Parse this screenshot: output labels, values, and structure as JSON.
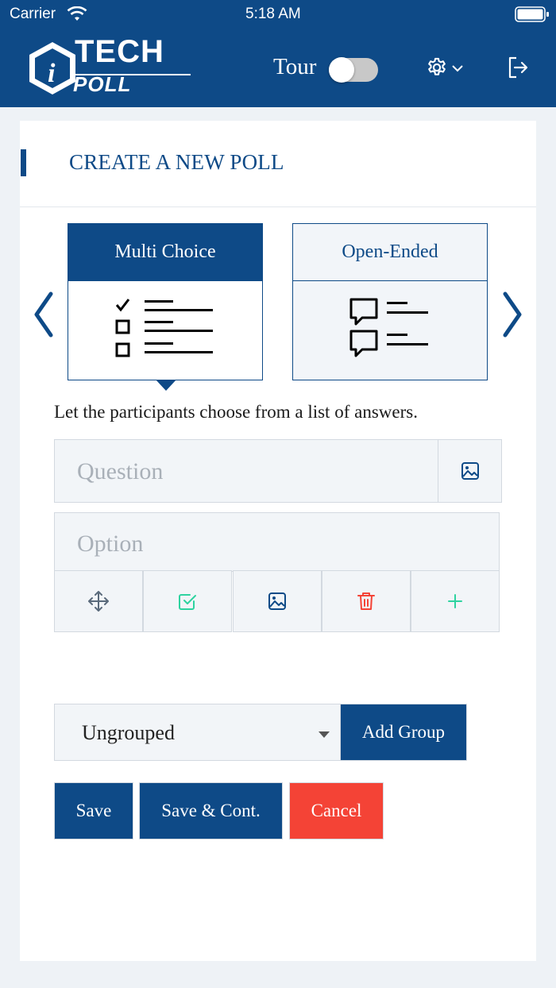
{
  "status_bar": {
    "carrier": "Carrier",
    "time": "5:18 AM"
  },
  "header": {
    "logo_text_top": "TECH",
    "logo_text_bottom": "POLL",
    "tour_label": "Tour",
    "tour_toggle_on": false,
    "settings_icon": "gear-icon",
    "logout_icon": "logout-icon"
  },
  "page": {
    "title": "CREATE A NEW POLL"
  },
  "poll_types": {
    "items": [
      {
        "label": "Multi Choice",
        "icon": "checklist-icon",
        "active": true
      },
      {
        "label": "Open-Ended",
        "icon": "chat-list-icon",
        "active": false
      }
    ],
    "description": "Let the participants choose from a list of answers."
  },
  "question": {
    "placeholder": "Question",
    "image_icon": "image-icon"
  },
  "option": {
    "placeholder": "Option",
    "tools": [
      "move-icon",
      "check-square-icon",
      "image-icon",
      "trash-icon",
      "plus-icon"
    ]
  },
  "group": {
    "selected": "Ungrouped",
    "add_label": "Add Group"
  },
  "actions": {
    "save": "Save",
    "save_cont": "Save & Cont.",
    "cancel": "Cancel"
  },
  "colors": {
    "primary": "#0e4a87",
    "danger": "#f44336",
    "accent_green": "#2ed3a0"
  }
}
